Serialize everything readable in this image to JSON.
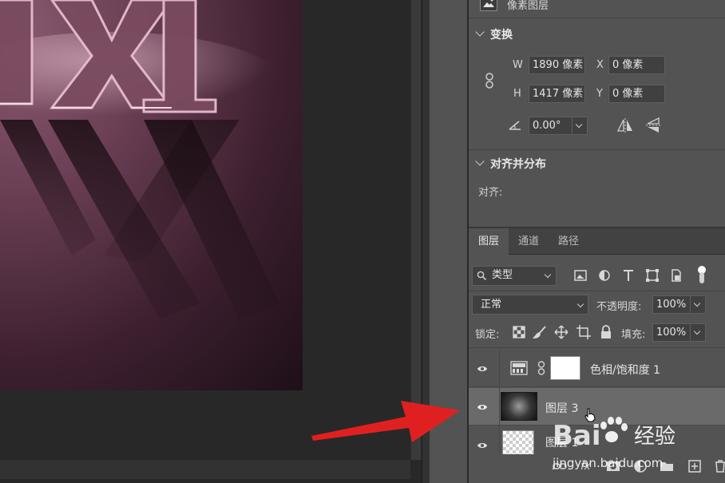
{
  "properties": {
    "layer_type_label": "像素图层",
    "transform": {
      "title": "变换",
      "w_label": "W",
      "w_value": "1890 像素",
      "h_label": "H",
      "h_value": "1417 像素",
      "x_label": "X",
      "x_value": "0 像素",
      "y_label": "Y",
      "y_value": "0 像素",
      "angle_value": "0.00°"
    },
    "align": {
      "title": "对齐并分布",
      "label": "对齐:"
    }
  },
  "layers_panel": {
    "tabs": [
      "图层",
      "通道",
      "路径"
    ],
    "active_tab": 0,
    "filter_kind": "类型",
    "blend_mode": "正常",
    "opacity_label": "不透明度:",
    "opacity_value": "100%",
    "lock_label": "锁定:",
    "fill_label": "填充:",
    "fill_value": "100%",
    "layers": [
      {
        "name": "色相/饱和度 1",
        "type": "adjustment"
      },
      {
        "name": "图层 3",
        "type": "pixel",
        "selected": true
      },
      {
        "name": "图层 1",
        "type": "pixel"
      }
    ],
    "bottom_label": "fx"
  },
  "watermark": {
    "brand": "Bai",
    "brand_suffix": "百",
    "product": "经验",
    "url": "jingyan.baidu.com"
  },
  "icons": [
    "link-icon",
    "chain-icon",
    "flip-horizontal-icon",
    "flip-vertical-icon",
    "angle-icon",
    "search-icon",
    "image-filter-icon",
    "adjustment-filter-icon",
    "text-filter-icon",
    "shape-filter-icon",
    "smartobject-filter-icon",
    "lock-transparent-icon",
    "lock-paint-icon",
    "lock-move-icon",
    "lock-artboard-icon",
    "lock-all-icon",
    "eye-icon",
    "trash-icon",
    "new-layer-icon",
    "folder-icon",
    "mask-icon",
    "adjustment-icon"
  ],
  "colors": {
    "panel_bg": "#535353",
    "canvas_bg": "#282828",
    "selected_row": "#6a6a6a",
    "arrow": "#e02020"
  }
}
